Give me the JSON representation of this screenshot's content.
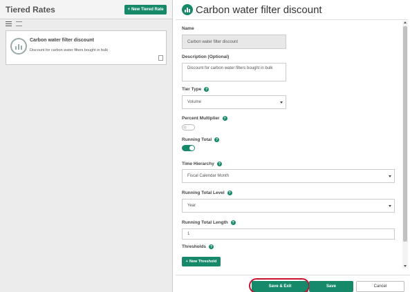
{
  "colors": {
    "accent": "#16896b",
    "highlight": "#c8102e"
  },
  "left": {
    "title": "Tiered Rates",
    "new_button": "New Tiered Rate",
    "card": {
      "title": "Carbon water filter discount",
      "description": "Discount for carbon water filters bought in bulk"
    }
  },
  "right": {
    "title": "Carbon water filter discount"
  },
  "form": {
    "name_label": "Name",
    "name_value": "Carbon water filter discount",
    "description_label": "Description (Optional)",
    "description_value": "Discount for carbon water filters bought in bulk",
    "tier_type_label": "Tier Type",
    "tier_type_value": "Volume",
    "percent_multiplier_label": "Percent Multiplier",
    "percent_multiplier_on": false,
    "running_total_label": "Running Total",
    "running_total_on": true,
    "time_hierarchy_label": "Time Hierarchy",
    "time_hierarchy_value": "Fiscal Calendar Month",
    "running_total_level_label": "Running Total Level",
    "running_total_level_value": "Year",
    "running_total_length_label": "Running Total Length",
    "running_total_length_value": "1",
    "thresholds_label": "Thresholds",
    "new_threshold_button": "New Threshold",
    "help_glyph": "?"
  },
  "footer": {
    "save_exit": "Save & Exit",
    "save": "Save",
    "cancel": "Cancel"
  }
}
